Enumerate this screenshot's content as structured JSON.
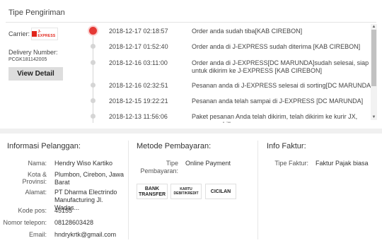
{
  "shipping": {
    "title": "Tipe Pengiriman",
    "carrier_label": "Carrier:",
    "carrier_logo_text": "J-EXPRESS",
    "delivery_number_label": "Delivery Number:",
    "delivery_number": "PCGK181142005",
    "view_detail_label": "View Detail",
    "events": [
      {
        "date": "2018-12-17 02:18:57",
        "text": "Order anda sudah tiba[KAB CIREBON]"
      },
      {
        "date": "2018-12-17 01:52:40",
        "text": "Order anda di J-EXPRESS sudah diterima [KAB CIREBON]"
      },
      {
        "date": "2018-12-16 03:11:00",
        "text": "Order anda di J-EXPRESS[DC MARUNDA]sudah selesai, siap untuk dikirim ke J-EXPRESS [KAB CIREBON]"
      },
      {
        "date": "2018-12-16 02:32:51",
        "text": "Pesanan anda di J-EXPRESS selesai di sorting[DC MARUNDA]"
      },
      {
        "date": "2018-12-15 19:22:21",
        "text": "Pesanan anda telah sampai di J-EXPRESS [DC MARUNDA]"
      },
      {
        "date": "2018-12-13 11:56:06",
        "text": "Paket pesanan Anda telah dikirim, telah dikirim ke kurir JX, nomor waybill"
      }
    ]
  },
  "customer": {
    "title": "Informasi Pelanggan:",
    "name_label": "Nama:",
    "name": "Hendry Wiso Kartiko",
    "city_label": "Kota & Provinsi:",
    "city": "Plumbon, Cirebon, Jawa Barat",
    "address_label": "Alamat:",
    "address": "PT Dharma Electrindo Manufacturing Jl. Wadas...",
    "postal_label": "Kode pos:",
    "postal": "45155",
    "phone_label": "Nomor telepon:",
    "phone": "08128603428",
    "email_label": "Email:",
    "email": "hndrykrtk@gmail.com"
  },
  "payment": {
    "title": "Metode Pembayaran:",
    "type_label": "Tipe Pembayaran:",
    "type": "Online Payment",
    "methods": [
      {
        "line1": "BANK",
        "line2": "TRANSFER"
      },
      {
        "line1": "KARTU",
        "line2": "DEBIT/KREDIT"
      },
      {
        "line1": "CICILAN",
        "line2": ""
      }
    ]
  },
  "invoice": {
    "title": "Info Faktur:",
    "type_label": "Tipe Faktur:",
    "type": "Faktur Pajak biasa"
  },
  "colors": {
    "accent": "#e53935",
    "carrier_brand": "#e1251b"
  }
}
